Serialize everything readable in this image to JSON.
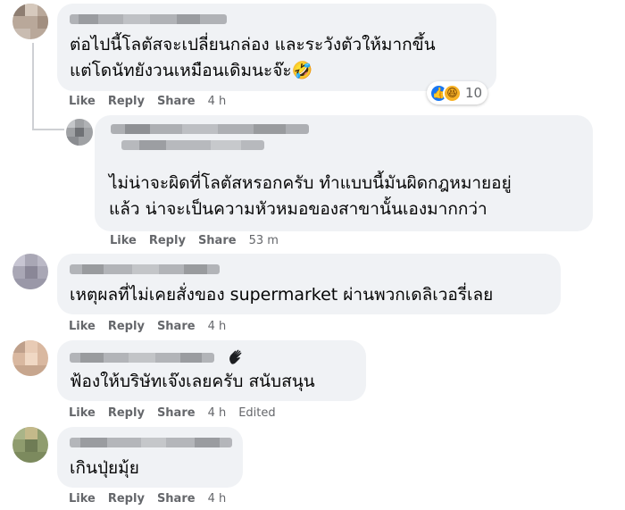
{
  "colors": {
    "bubble": "#f0f2f5",
    "action_text": "#65676b",
    "like_blue": "#1877f2",
    "haha_yellow": "#f7b125"
  },
  "comments": [
    {
      "text_lines": [
        "ต่อไปนี้โลตัสจะเปลี่ยนกล่อง และระวังตัวให้มากขึ้น",
        "แต่โดนัทยังวนเหมือนเดิมนะจ๊ะ🤣"
      ],
      "actions": {
        "like": "Like",
        "reply": "Reply",
        "share": "Share",
        "time": "4 h"
      },
      "reactions": {
        "icons": [
          "like-icon",
          "haha-icon"
        ],
        "count": "10"
      }
    },
    {
      "text_lines": [
        "ไม่น่าจะผิดที่โลตัสหรอกครับ ทำแบบนี้มันผิดกฎหมายอยู่",
        "แล้ว น่าจะเป็นความหัวหมอของสาขานั้นเองมากกว่า"
      ],
      "actions": {
        "like": "Like",
        "reply": "Reply",
        "share": "Share",
        "time": "53 m"
      }
    },
    {
      "text_lines": [
        "เหตุผลที่ไม่เคยสั่งของ supermarket ผ่านพวกเดลิเวอรี่เลย"
      ],
      "actions": {
        "like": "Like",
        "reply": "Reply",
        "share": "Share",
        "time": "4 h"
      }
    },
    {
      "text_lines": [
        "ฟ้องให้บริษัทเจ๊งเลยครับ สนับสนุน"
      ],
      "badge": "wave-hand-icon",
      "actions": {
        "like": "Like",
        "reply": "Reply",
        "share": "Share",
        "time": "4 h",
        "edited": "Edited"
      }
    },
    {
      "text_lines": [
        "เกินปุ่ยมุ้ย"
      ],
      "actions": {
        "like": "Like",
        "reply": "Reply",
        "share": "Share",
        "time": "4 h"
      }
    }
  ]
}
